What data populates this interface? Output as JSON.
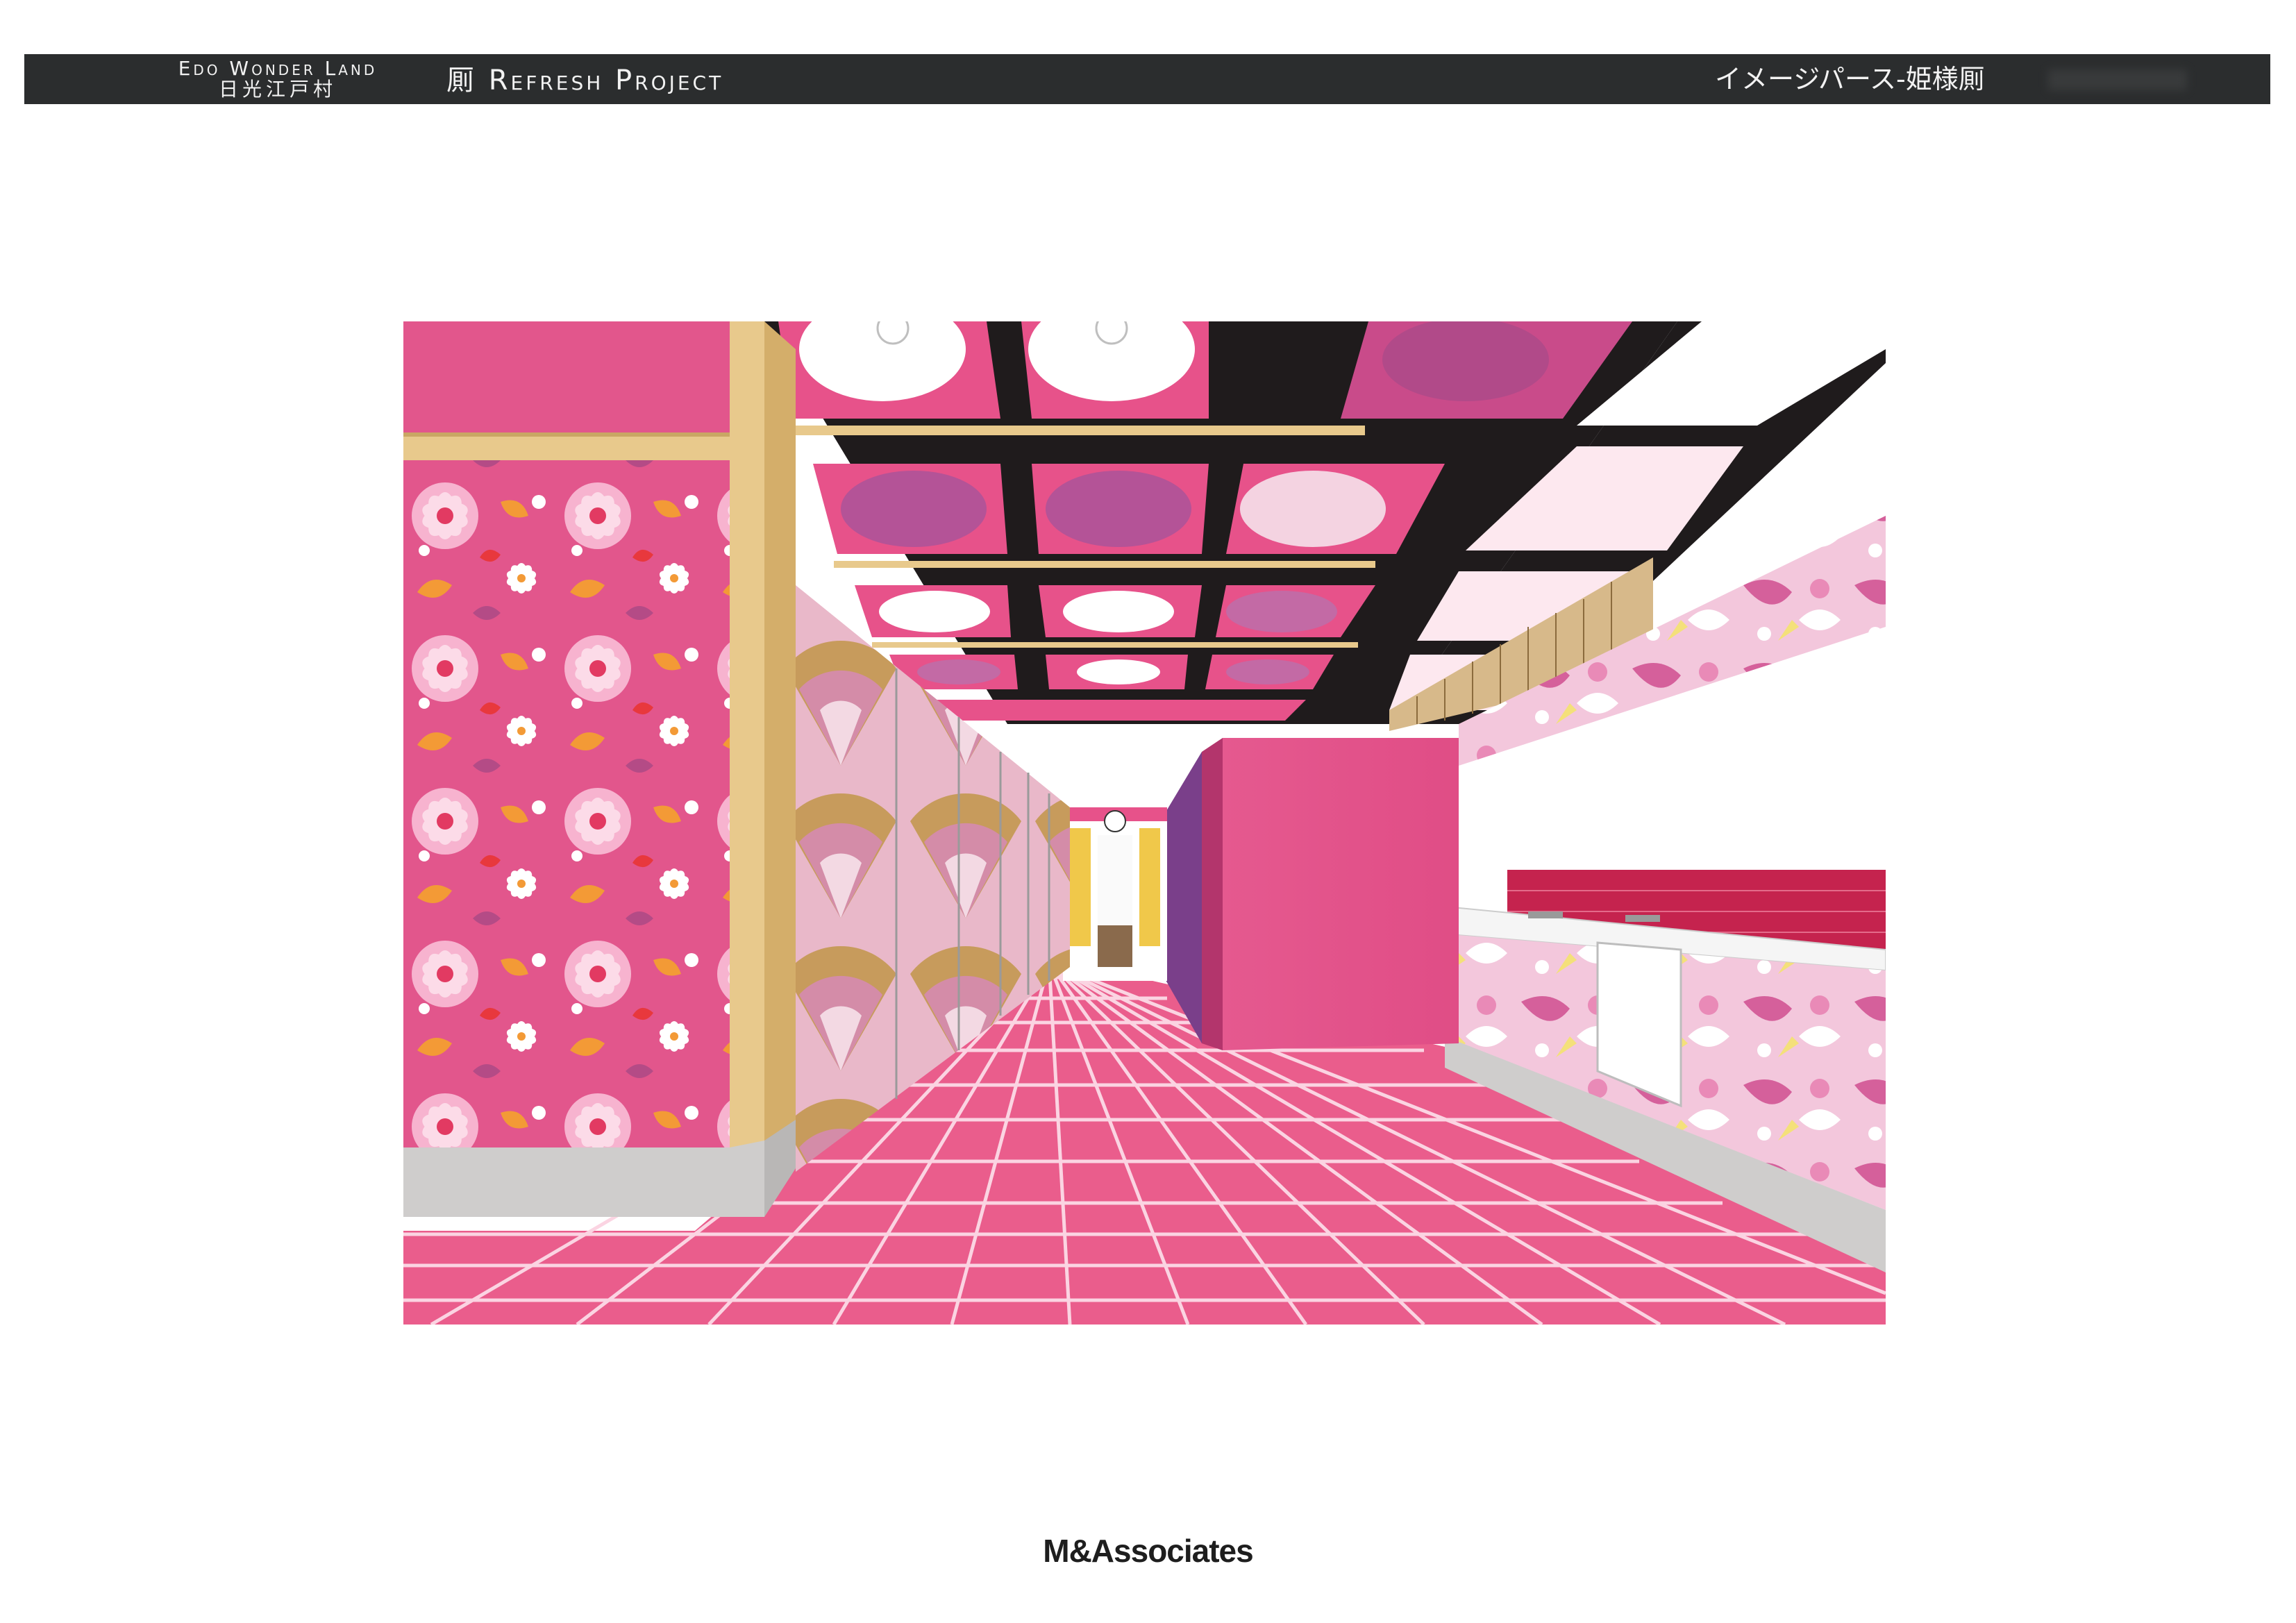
{
  "header": {
    "brand_en": "Edo Wonder Land",
    "brand_jp": "日光江戸村",
    "project_title": "厠 Refresh Project",
    "sheet_title": "イメージパース-姫様厠"
  },
  "rendering": {
    "subject": "princess-restroom-interior-perspective",
    "colors": {
      "floor_tile": "#ea5d8c",
      "grout": "#fbd4e2",
      "wall_pink": "#e2568c",
      "ceiling_beam": "#1f1b1c",
      "wood": "#e8c98c",
      "baseboard": "#c9c7c6",
      "counter_tile": "#c5234e"
    }
  },
  "footer": {
    "company": "M&Associates"
  }
}
